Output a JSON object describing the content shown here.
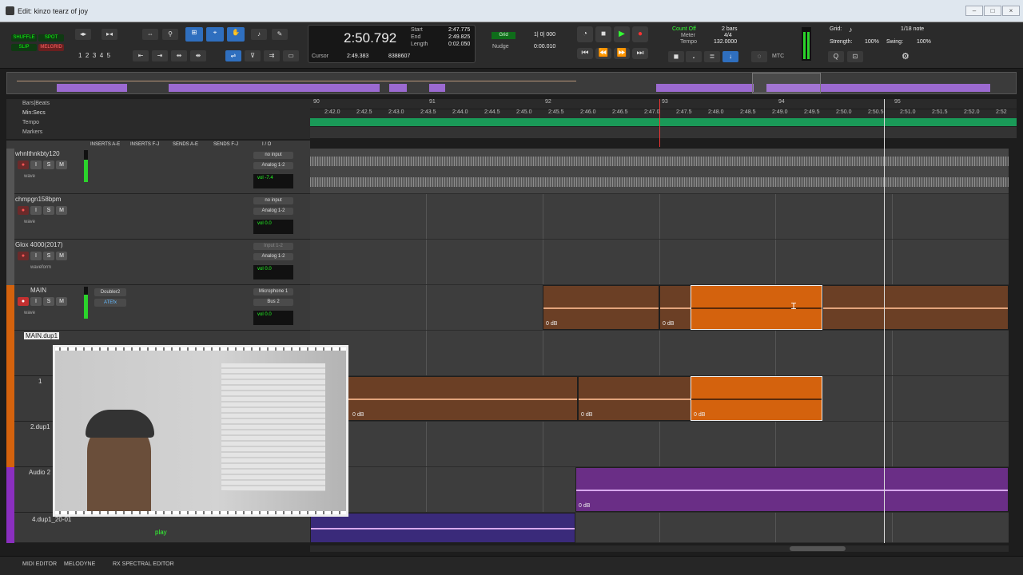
{
  "window": {
    "title": "Edit: kinzo tearz of joy"
  },
  "modes": {
    "shuffle": "SHUFFLE",
    "spot": "SPOT",
    "slip": "SLIP",
    "grid": "MELGRID"
  },
  "zoom_presets": [
    "1",
    "2",
    "3",
    "4",
    "5"
  ],
  "counter": {
    "main": "2:50.792",
    "start_label": "Start",
    "start": "2:47.775",
    "end_label": "End",
    "end": "2:49.825",
    "length_label": "Length",
    "length": "0:02.050",
    "cursor_label": "Cursor",
    "cursor": "2:49.383",
    "cursor_sample": "8388607"
  },
  "grid_nudge": {
    "grid_label": "Grid",
    "grid_value": "1| 0| 000",
    "nudge_label": "Nudge",
    "nudge_value": "0:00.010"
  },
  "count_off": {
    "label": "Count Off",
    "bars": "2 bars",
    "meter_label": "Meter",
    "meter": "4/4",
    "tempo_label": "Tempo",
    "tempo": "132.0000"
  },
  "grid_panel": {
    "grid_label": "Grid:",
    "grid_value": "1/18 note",
    "strength_label": "Strength:",
    "strength": "100%",
    "swing_label": "Swing:",
    "swing": "100%"
  },
  "mtc": "MTC",
  "rulers": {
    "bars_beats": "Bars|Beats",
    "min_secs": "Min:Secs",
    "tempo": "Tempo",
    "markers": "Markers"
  },
  "bar_numbers": [
    "90",
    "91",
    "92",
    "93",
    "94",
    "95"
  ],
  "time_ticks": [
    "2:42.0",
    "2:42.5",
    "2:43.0",
    "2:43.5",
    "2:44.0",
    "2:44.5",
    "2:45.0",
    "2:45.5",
    "2:46.0",
    "2:46.5",
    "2:47.0",
    "2:47.5",
    "2:48.0",
    "2:48.5",
    "2:49.0",
    "2:49.5",
    "2:50.0",
    "2:50.5",
    "2:51.0",
    "2:51.5",
    "2:52.0",
    "2:52"
  ],
  "columns": {
    "inserts_ae": "INSERTS A-E",
    "inserts_fj": "INSERTS F-J",
    "sends_ae": "SENDS A-E",
    "sends_fj": "SENDS F-J",
    "io": "I / O"
  },
  "tracks": [
    {
      "name": "whnlthnkbty120",
      "io_in": "no input",
      "io_out": "Analog 1-2",
      "vol": "-7.4",
      "pan": "100  100",
      "view": "wave",
      "color": "#555555"
    },
    {
      "name": "chmpgn158bpm",
      "io_in": "no input",
      "io_out": "Analog 1-2",
      "vol": "0.0",
      "pan": "100  100",
      "view": "wave",
      "color": "#555555"
    },
    {
      "name": "Glox 4000(2017)",
      "io_in": "Input 1-2",
      "io_out": "Analog 1-2",
      "vol": "0.0",
      "pan": "100  100",
      "view": "waveform",
      "color": "#555555"
    },
    {
      "name": "MAIN",
      "io_in": "Microphone 1",
      "io_out": "Bus 2",
      "vol": "0.0",
      "pan": "",
      "view": "wave",
      "color": "#d4620d",
      "insert1": "Doubler2",
      "insert2": "ATEfx"
    },
    {
      "name": "MAIN.dup1",
      "view": "wave",
      "color": "#d4620d"
    },
    {
      "name": "1",
      "view": "wave",
      "color": "#d4620d"
    },
    {
      "name": "2.dup1",
      "view": "wave",
      "color": "#d4620d"
    },
    {
      "name": "Audio 2",
      "view": "play",
      "color": "#8a2fbf"
    },
    {
      "name": "4.dup1_20-01",
      "view": "",
      "color": "#8a2fbf"
    }
  ],
  "clip_gain": "0 dB",
  "status": {
    "play": "play"
  },
  "bottom_tabs": [
    "MIDI EDITOR",
    "MELODYNE",
    "RX SPECTRAL EDITOR"
  ]
}
